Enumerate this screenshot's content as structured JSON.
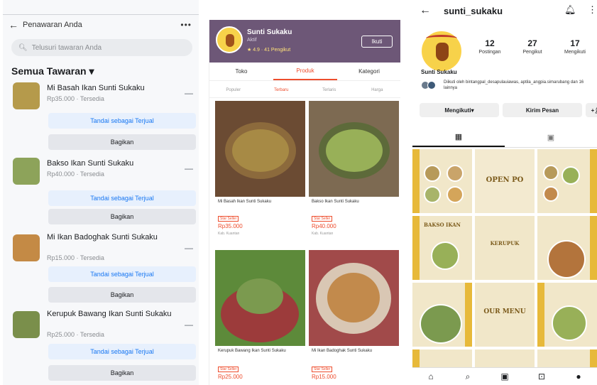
{
  "marketplace": {
    "header_title": "Penawaran Anda",
    "more_label": "•••",
    "search_placeholder": "Telusuri tawaran Anda",
    "section_title": "Semua Tawaran",
    "items": [
      {
        "title": "Mi Basah Ikan Sunti Sukaku",
        "subtitle": "Rp35.000 · Tersedia",
        "mark_label": "Tandai sebagai Terjual",
        "share_label": "Bagikan",
        "color": "#b59a4b"
      },
      {
        "title": "Bakso Ikan Sunti Sukaku",
        "subtitle": "Rp40.000 · Tersedia",
        "mark_label": "Tandai sebagai Terjual",
        "share_label": "Bagikan",
        "color": "#8da35a"
      },
      {
        "title": "Mi Ikan Badoghak Sunti Sukaku",
        "subtitle": "Rp15.000 · Tersedia",
        "mark_label": "Tandai sebagai Terjual",
        "share_label": "Bagikan",
        "color": "#c48a45"
      },
      {
        "title": "Kerupuk Bawang Ikan Sunti Sukaku",
        "subtitle": "Rp25.000 · Tersedia",
        "mark_label": "Tandai sebagai Terjual",
        "share_label": "Bagikan",
        "color": "#7a8f4b"
      }
    ]
  },
  "shop": {
    "name": "Sunti Sukaku",
    "status": "Aktif",
    "meta": "★ 4.9 · 41 Pengikut",
    "follow_label": "Ikuti",
    "tabs": [
      "Toko",
      "Produk",
      "Kategori"
    ],
    "sort_options": [
      "Populer",
      "Terbaru",
      "Terlaris",
      "Harga"
    ],
    "products": [
      {
        "name": "Mi Basah Ikan Sunti Sukaku",
        "badge": "Star Seller",
        "price": "Rp35.000",
        "location": "Kab. Kuantan",
        "color": "#a78a45"
      },
      {
        "name": "Bakso Ikan Sunti Sukaku",
        "badge": "Star Seller",
        "price": "Rp40.000",
        "location": "Kab. Kuantan",
        "color": "#98b058"
      },
      {
        "name": "Kerupuk Bawang Ikan Sunti Sukaku",
        "badge": "Star Seller",
        "price": "Rp25.000",
        "location": "",
        "color": "#7b9a4f"
      },
      {
        "name": "Mi Ikan Badoghak Sunti Sukaku",
        "badge": "Star Seller",
        "price": "Rp15.000",
        "location": "",
        "color": "#c28a4c"
      }
    ]
  },
  "instagram": {
    "username": "sunti_sukaku",
    "stats": [
      {
        "num": "12",
        "label": "Postingan"
      },
      {
        "num": "27",
        "label": "Pengikut"
      },
      {
        "num": "17",
        "label": "Mengikuti"
      }
    ],
    "display_name": "Sunti Sukaku",
    "followed_by": "Diikuti oleh bintangpal_desapulauiawas, aptila_angpia.simarubang dan 16 lainnya",
    "buttons": [
      "Mengikuti",
      "Kirim Pesan"
    ],
    "posts": [
      {
        "caption": "",
        "bg": "#f1e7c9"
      },
      {
        "caption": "OPEN PO",
        "bg": "#f3ead0"
      },
      {
        "caption": "",
        "bg": "#f1e7c9"
      },
      {
        "caption": "BAKSO IKAN",
        "bg": "#f1e7c9"
      },
      {
        "caption": "KERUPUK",
        "bg": "#f3ead0"
      },
      {
        "caption": "",
        "bg": "#f1e7c9"
      },
      {
        "caption": "",
        "bg": "#f1e7c9"
      },
      {
        "caption": "OUR MENU",
        "bg": "#f3ead0"
      },
      {
        "caption": "",
        "bg": "#f1e7c9"
      }
    ]
  }
}
